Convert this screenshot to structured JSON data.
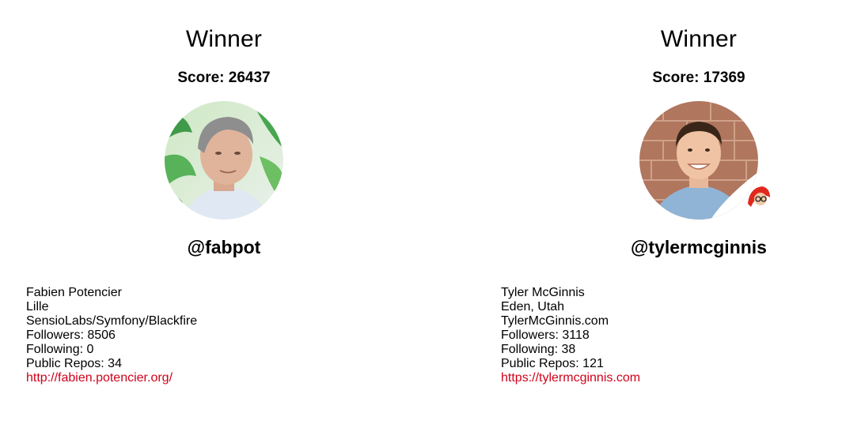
{
  "players": [
    {
      "header": "Winner",
      "score_label": "Score: 26437",
      "handle": "@fabpot",
      "avatar_icon": "avatar-photo-icon",
      "name": "Fabien Potencier",
      "location": "Lille",
      "company": "SensioLabs/Symfony/Blackfire",
      "followers": "Followers: 8506",
      "following": "Following: 0",
      "public_repos": "Public Repos: 34",
      "blog": "http://fabien.potencier.org/"
    },
    {
      "header": "Winner",
      "score_label": "Score: 17369",
      "handle": "@tylermcginnis",
      "avatar_icon": "avatar-photo-icon",
      "name": "Tyler McGinnis",
      "location": "Eden, Utah",
      "company": "TylerMcGinnis.com",
      "followers": "Followers: 3118",
      "following": "Following: 38",
      "public_repos": "Public Repos: 121",
      "blog": "https://tylermcginnis.com"
    }
  ],
  "colors": {
    "link": "#d0021b",
    "text": "#000000",
    "background": "#ffffff"
  }
}
